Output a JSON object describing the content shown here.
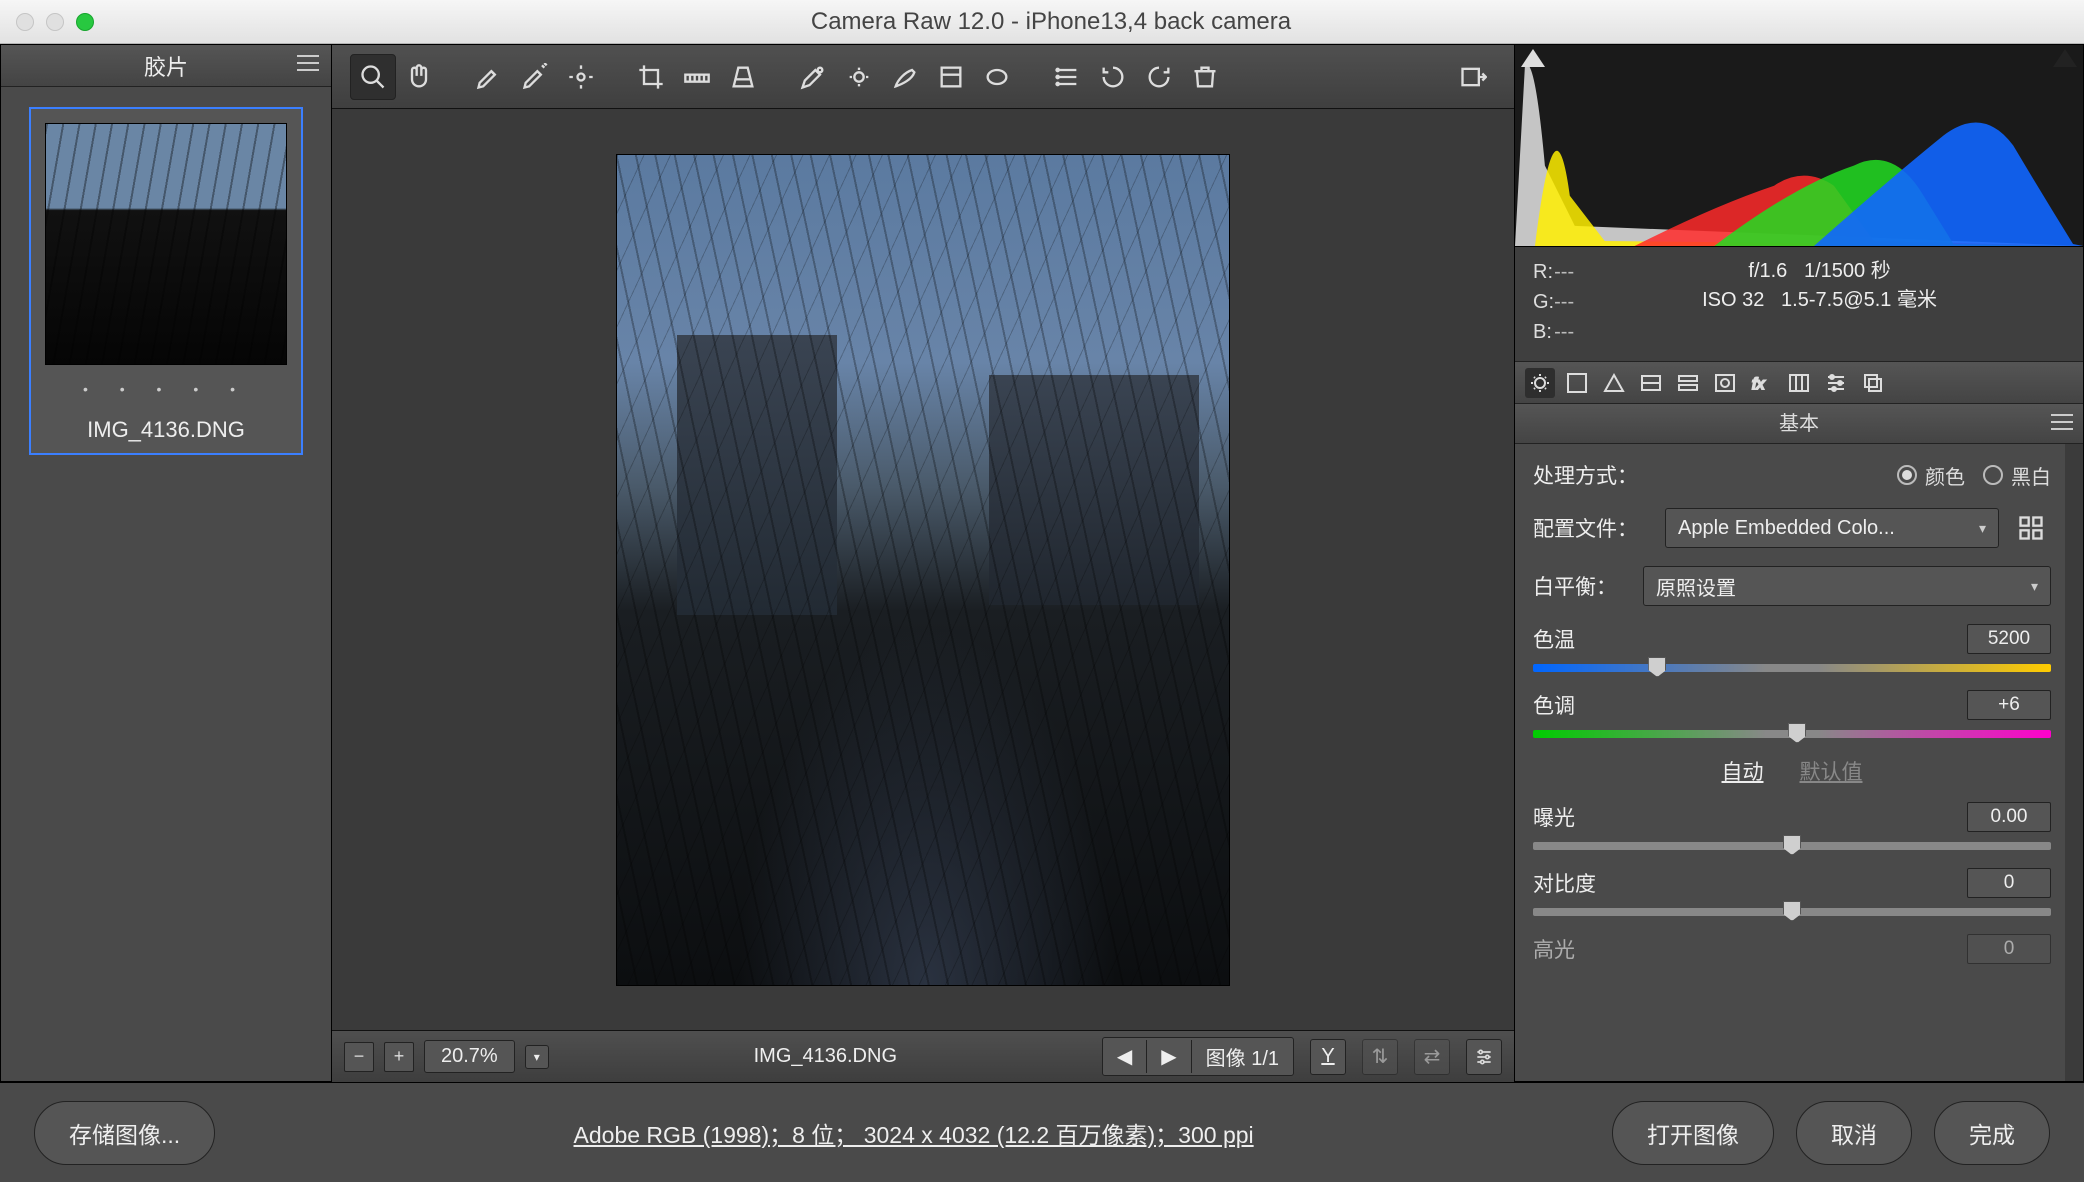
{
  "window": {
    "title": "Camera Raw 12.0 -  iPhone13,4 back camera"
  },
  "filmstrip": {
    "header": "胶片",
    "dots": "• • • • •",
    "thumb_name": "IMG_4136.DNG"
  },
  "statusbar": {
    "zoom": "20.7%",
    "filename": "IMG_4136.DNG",
    "pageinfo": "图像 1/1",
    "ybtn": "Y"
  },
  "readout": {
    "r_label": "R:",
    "r_val": "---",
    "g_label": "G:",
    "g_val": "---",
    "b_label": "B:",
    "b_val": "---",
    "exif_line1_a": "f/1.6",
    "exif_line1_b": "1/1500 秒",
    "exif_line2_a": "ISO 32",
    "exif_line2_b": "1.5-7.5@5.1 毫米"
  },
  "panel": {
    "name": "基本",
    "treatment_label": "处理方式：",
    "treatment_color": "颜色",
    "treatment_bw": "黑白",
    "profile_label": "配置文件：",
    "profile_value": "Apple Embedded Colo...",
    "wb_label": "白平衡：",
    "wb_value": "原照设置",
    "temp_label": "色温",
    "temp_value": "5200",
    "tint_label": "色调",
    "tint_value": "+6",
    "auto": "自动",
    "default": "默认值",
    "exposure_label": "曝光",
    "exposure_value": "0.00",
    "contrast_label": "对比度",
    "contrast_value": "0",
    "highlights_label": "高光",
    "highlights_value": "0"
  },
  "footer": {
    "save": "存储图像...",
    "info": "Adobe RGB (1998)；8 位； 3024 x 4032 (12.2 百万像素)；300 ppi",
    "open": "打开图像",
    "cancel": "取消",
    "done": "完成"
  }
}
